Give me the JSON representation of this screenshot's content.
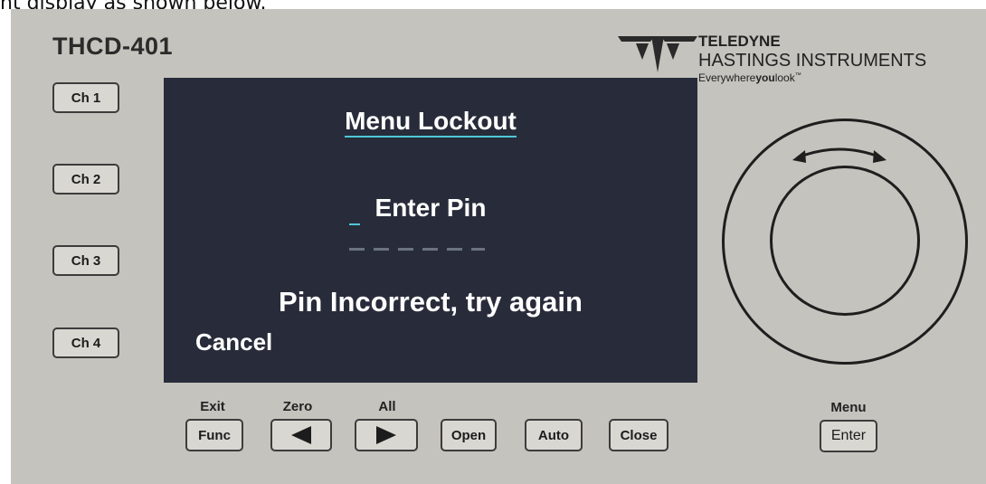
{
  "caption": "nt display as shown below.",
  "panel": {
    "model": "THCD-401",
    "channels": [
      "Ch 1",
      "Ch 2",
      "Ch 3",
      "Ch 4"
    ],
    "logo": {
      "brand": "TELEDYNE",
      "division": "HASTINGS INSTRUMENTS",
      "tagline_a": "Everywhere",
      "tagline_b": "you",
      "tagline_c": "look",
      "tm": "™"
    },
    "screen": {
      "title": "Menu Lockout",
      "prompt": "Enter Pin",
      "message": "Pin Incorrect, try again",
      "cancel": "Cancel"
    },
    "bottom_labels": {
      "exit": "Exit",
      "zero": "Zero",
      "all": "All",
      "menu": "Menu"
    },
    "bottom_buttons": {
      "func": "Func",
      "open": "Open",
      "auto": "Auto",
      "close": "Close",
      "enter": "Enter"
    },
    "icons": {
      "left": "arrow-left-icon",
      "right": "arrow-right-icon",
      "rotate": "rotate-arrow-icon",
      "logo": "teledyne-logo-icon"
    }
  }
}
